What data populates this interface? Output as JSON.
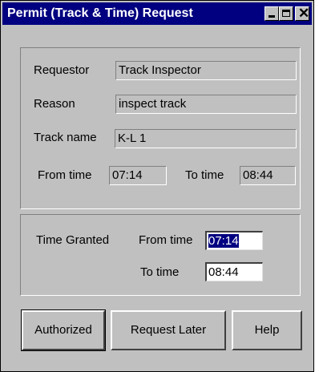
{
  "window": {
    "title": "Permit (Track & Time) Request"
  },
  "request": {
    "requestor_label": "Requestor",
    "requestor_value": "Track Inspector",
    "reason_label": "Reason",
    "reason_value": "inspect track",
    "track_label": "Track name",
    "track_value": "K-L 1",
    "from_label": "From time",
    "from_value": "07:14",
    "to_label": "To time",
    "to_value": "08:44"
  },
  "granted": {
    "section_label": "Time Granted",
    "from_label": "From time",
    "from_value": "07:14",
    "to_label": "To time",
    "to_value": "08:44"
  },
  "buttons": {
    "authorized": "Authorized",
    "request_later": "Request Later",
    "help": "Help"
  },
  "icons": {
    "minimize": "minimize-icon",
    "maximize": "maximize-icon",
    "close": "close-icon"
  }
}
